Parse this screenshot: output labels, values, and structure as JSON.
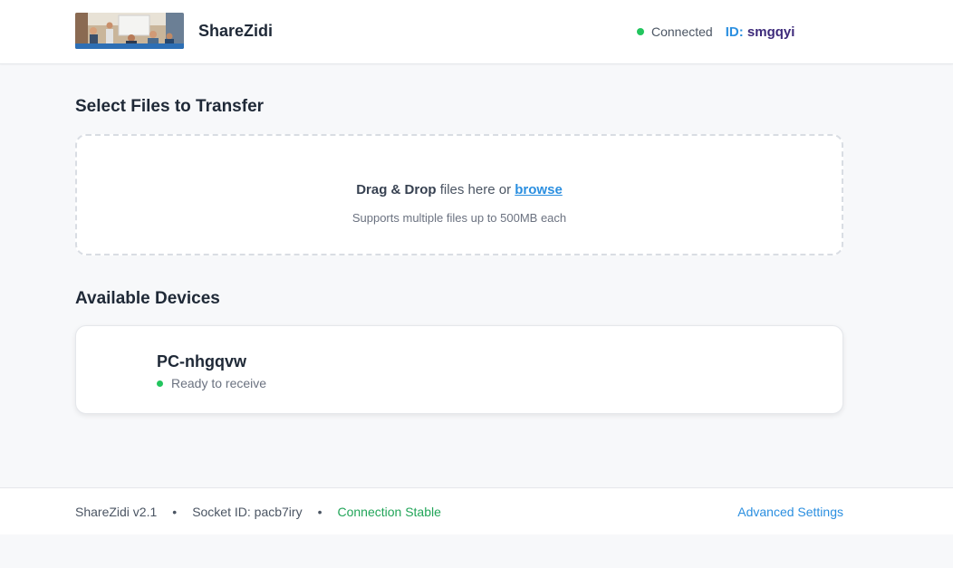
{
  "header": {
    "app_name": "ShareZidi",
    "status": "Connected",
    "id_label": "ID:",
    "id_value": "smgqyi"
  },
  "upload": {
    "title": "Select Files to Transfer",
    "drag_drop": "Drag & Drop",
    "files_here_or": " files here or ",
    "browse": "browse",
    "supports": "Supports multiple files up to 500MB each"
  },
  "devices": {
    "title": "Available Devices",
    "items": [
      {
        "name": "PC-nhgqvw",
        "status": "Ready to receive"
      }
    ]
  },
  "footer": {
    "version": "ShareZidi v2.1",
    "separator": "•",
    "socket_id": "Socket ID: pacb7iry",
    "connection": "Connection Stable",
    "advanced_settings": "Advanced Settings"
  },
  "colors": {
    "accent": "#2b8fe0",
    "status_green": "#22c55e",
    "id_value": "#3d2a7a"
  }
}
